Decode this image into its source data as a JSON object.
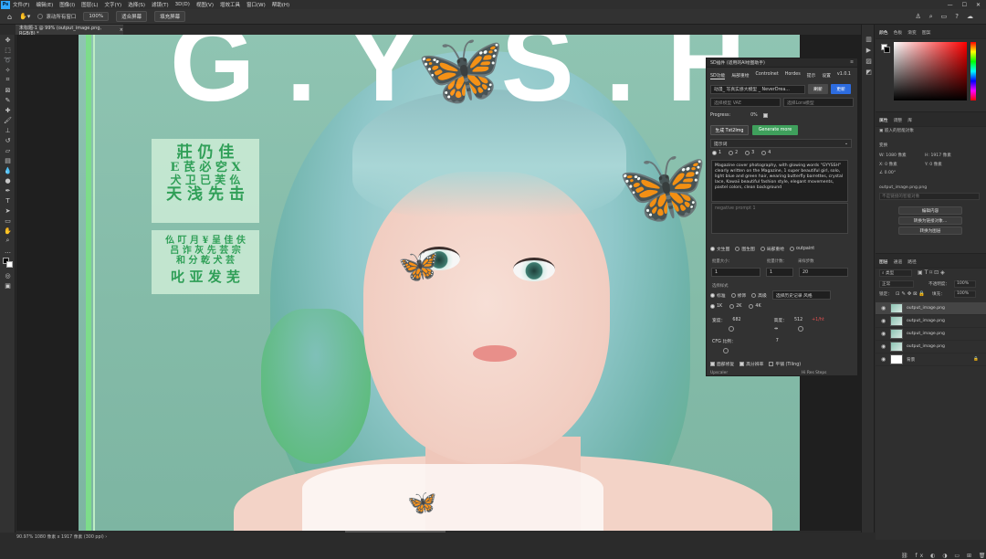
{
  "app": {
    "logo": "Ps",
    "menus": [
      "文件(F)",
      "编辑(E)",
      "图像(I)",
      "图层(L)",
      "文字(Y)",
      "选择(S)",
      "滤镜(T)",
      "3D(D)",
      "视图(V)",
      "增效工具",
      "窗口(W)",
      "帮助(H)"
    ],
    "window_controls": [
      "—",
      "☐",
      "✕"
    ]
  },
  "options_bar": {
    "checkbox_label": "滚动所有窗口",
    "zoom": "100%",
    "fit_screen": "适合屏幕",
    "fill_screen": "填充屏幕"
  },
  "document": {
    "tab_title": "未标题-1 @ 99% (output_image.png, RGB/8) *",
    "status": "90.97%   1080 像素 x 1917 像素 (300 ppi)   ›"
  },
  "artwork": {
    "big_title": "G.Y.S.H.",
    "block1_lines": [
      "莊 仍 佳",
      "E 芪 必 穵 X",
      "犬 卫 已 芙 仫",
      "天 浅 先 击"
    ],
    "block2_lines": [
      "仫 叮 月 ¥ 呈 佳 伕",
      "吕 诈 灰 先 芸 宗",
      "和 分 乾 犬 芸"
    ],
    "block2_last": "叱 亚 发 芜"
  },
  "sd_panel": {
    "header": "SD插件 (适用的AI绘图助手)",
    "tabs": [
      "SD功能",
      "局部重绘",
      "Controlnet",
      "Hordes",
      "提示",
      "设置",
      "v1.0.1"
    ],
    "model": "动漫_ 写真实感大模型 _ NeverDrea...",
    "refresh_btn": "刷新",
    "update_btn": "更新",
    "model_placeholder1": "选择模型 VAE",
    "model_placeholder2": "选择Lora模型",
    "progress_label": "Progress:",
    "progress_value": "0%",
    "btn_generate_cn": "生成 Txt2Img",
    "btn_generate_more": "Generate more",
    "prompt_header": "提示词",
    "prompt_tabs": [
      "1",
      "2",
      "3",
      "4"
    ],
    "prompt_text": "Magazine cover photography, with glowing words \"GYYSSH\" clearly written on the Magazine, 1 super beautiful girl, solo, light blue and green hair, wearing butterfly barrettes, crystal lace, Kawaii beautiful fashion style, elegant movements, pastel colors, clean background",
    "negative_placeholder": "negative prompt 1",
    "mode_options": [
      "文生图",
      "图生图",
      "局部重绘",
      "outpaint"
    ],
    "batch_count_label": "批量大小：",
    "batch_count": "1",
    "batch_size_label": "批量计数：",
    "batch_size": "1",
    "steps_label": "采样步数",
    "steps": "20",
    "sampler_label": "选择样式",
    "res_options": [
      "标准",
      "修饰",
      "高级"
    ],
    "style_select": "选择历史记录 风格",
    "size_options": [
      "1K",
      "2K",
      "4K"
    ],
    "width_label": "宽度：",
    "width": "682",
    "height_label": "高度：",
    "height": "512",
    "height_extra": "+1/ht",
    "cfg_label": "CFG 比例：",
    "cfg": "7",
    "opts": [
      "面部修复",
      "高分辨率",
      "平铺 (Tiling)"
    ],
    "bottom_left": "Upscaler",
    "bottom_right": "Hi Res Steps"
  },
  "right_panels": {
    "color_tabs": [
      "颜色",
      "色板",
      "渐变",
      "图案"
    ],
    "props_tabs": [
      "属性",
      "调整",
      "库"
    ],
    "props_label_pixel": "嵌入的智能对象",
    "transform": "变换",
    "w_label": "W: 1080 像素",
    "h_label": "H: 1917 像素",
    "x_label": "X: 0 像素",
    "y_label": "Y: 0 像素",
    "angle": "0.00°",
    "file_name": "output_image.png.png",
    "file_placeholder": "不是链接的智能对象",
    "btn_edit": "编辑内容",
    "btn_convert": "转换为链接对象...",
    "btn_convert_layer": "转换为图层",
    "layers_tabs": [
      "图层",
      "通道",
      "路径"
    ],
    "filter_kind": "类型",
    "blend_mode": "正常",
    "opacity_label": "不透明度：",
    "opacity": "100%",
    "lock_label": "锁定：",
    "fill_label": "填充：",
    "fill": "100%",
    "layers": [
      "output_image.png",
      "output_image.png",
      "output_image.png",
      "output_image.png",
      "背景"
    ]
  }
}
